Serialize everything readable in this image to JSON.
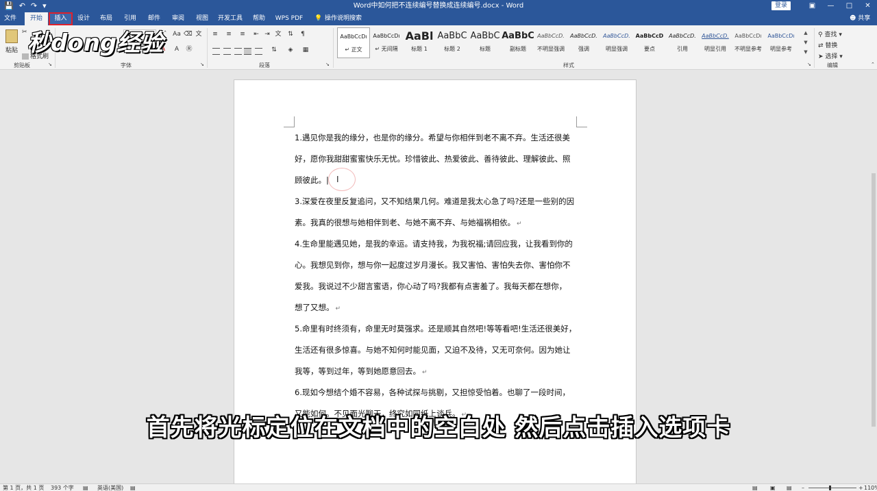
{
  "colors": {
    "titlebar": "#2b579a",
    "highlight_box": "#e0202a"
  },
  "titlebar": {
    "title": "Word中如何把不连续编号替换成连续编号.docx - Word",
    "login": "登录",
    "qat": [
      "save-icon",
      "undo-icon",
      "redo-icon",
      "customize-icon"
    ]
  },
  "tabs": [
    "文件",
    "开始",
    "插入",
    "设计",
    "布局",
    "引用",
    "邮件",
    "审阅",
    "视图",
    "开发工具",
    "帮助",
    "WPS PDF",
    "操作说明搜索"
  ],
  "share": "共享",
  "ribbon": {
    "clipboard": {
      "paste": "粘贴",
      "format_painter": "格式刷",
      "label": "剪贴板"
    },
    "font": {
      "label": "字体"
    },
    "paragraph": {
      "label": "段落"
    },
    "styles": {
      "label": "样式",
      "items": [
        {
          "preview": "AaBbCcDı",
          "name": "↵ 正文"
        },
        {
          "preview": "AaBbCcDı",
          "name": "↵ 无间隔"
        },
        {
          "preview": "AaBl",
          "name": "标题 1"
        },
        {
          "preview": "AaBbC",
          "name": "标题 2"
        },
        {
          "preview": "AaBbC",
          "name": "标题"
        },
        {
          "preview": "AaBbC",
          "name": "副标题"
        },
        {
          "preview": "AaBbCcD.",
          "name": "不明显强调"
        },
        {
          "preview": "AaBbCcD.",
          "name": "强调"
        },
        {
          "preview": "AaBbCcD.",
          "name": "明显强调"
        },
        {
          "preview": "AaBbCcD",
          "name": "要点"
        },
        {
          "preview": "AaBbCcD.",
          "name": "引用"
        },
        {
          "preview": "AaBbCcD.",
          "name": "明显引用"
        },
        {
          "preview": "AaBbCcDı",
          "name": "不明显参考"
        },
        {
          "preview": "AaBbCcDı",
          "name": "明显参考"
        }
      ]
    },
    "editing": {
      "find": "查找",
      "replace": "替换",
      "select": "选择",
      "label": "编辑"
    }
  },
  "logo": "秒dong经验",
  "document": {
    "lines": [
      {
        "text": "1.遇见你是我的缘分，也是你的缘分。希望与你相伴到老不离不弃。生活还很美",
        "mark": ""
      },
      {
        "text": "好，愿你我甜甜蜜蜜快乐无忧。珍惜彼此、热爱彼此、善待彼此、理解彼此、照",
        "mark": ""
      },
      {
        "text": "顾彼此。|",
        "mark": ""
      },
      {
        "text": "3.深爱在夜里反复追问，又不知结果几何。难道是我太心急了吗?还是一些别的因",
        "mark": ""
      },
      {
        "text": "素。我真的很想与她相伴到老、与她不离不弃、与她福祸相依。",
        "mark": "↵"
      },
      {
        "text": "4.生命里能遇见她，是我的幸运。请支持我，为我祝福;请回应我，让我看到你的",
        "mark": ""
      },
      {
        "text": "心。我想见到你，想与你一起度过岁月漫长。我又害怕、害怕失去你、害怕你不",
        "mark": ""
      },
      {
        "text": "爱我。我说过不少甜言蜜语，你心动了吗?我都有点害羞了。我每天都在想你，",
        "mark": ""
      },
      {
        "text": "想了又想。",
        "mark": "↵"
      },
      {
        "text": "5.命里有时终须有，命里无时莫强求。还是顺其自然吧!等等看吧!生活还很美好，",
        "mark": ""
      },
      {
        "text": "生活还有很多惊喜。与她不知何时能见面，又迫不及待，又无可奈何。因为她让",
        "mark": ""
      },
      {
        "text": "我等，等到过年，等到她愿意回去。",
        "mark": "↵"
      },
      {
        "text": "6.现如今想结个婚不容易，各种试探与挑剔，又担惊受怕着。也聊了一段时间，",
        "mark": ""
      },
      {
        "text": "又能如何。不见面光聊天，终究如同纸上谈兵。",
        "mark": "↵"
      }
    ]
  },
  "caption": "首先将光标定位在文档中的空白处  然后点击插入选项卡",
  "status": {
    "page": "第 1 页，共 1 页",
    "words": "393 个字",
    "lang": "英语(美国)",
    "zoom": "110%"
  }
}
